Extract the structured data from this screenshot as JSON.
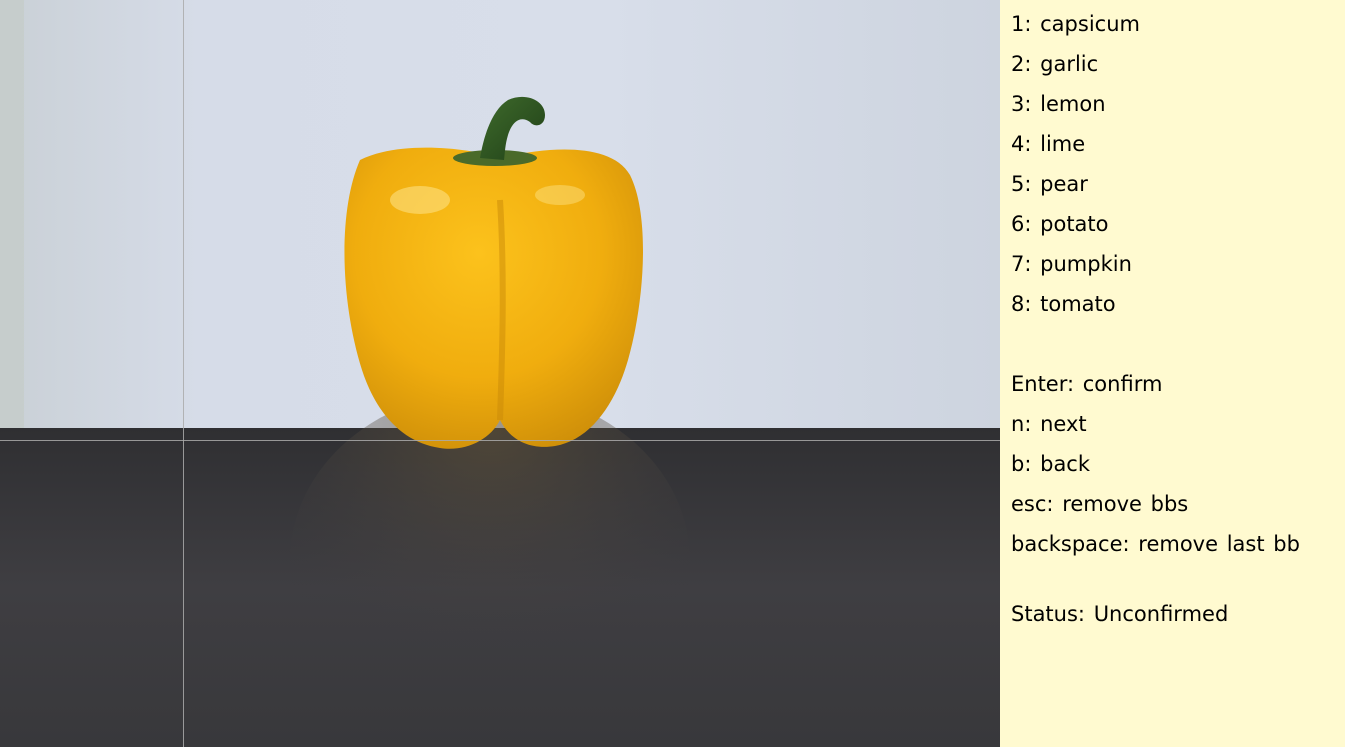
{
  "colors": {
    "panel_background": "#fffad0",
    "text": "#000000",
    "crosshair": "#aaaaaa",
    "pepper": "#f2b20f",
    "wall": "#cfd6e0",
    "table": "#3c3b3e"
  },
  "canvas": {
    "content": "yellow bell pepper on dark table against light wall"
  },
  "labels": [
    {
      "key": "1",
      "name": "capsicum"
    },
    {
      "key": "2",
      "name": "garlic"
    },
    {
      "key": "3",
      "name": "lemon"
    },
    {
      "key": "4",
      "name": "lime"
    },
    {
      "key": "5",
      "name": "pear"
    },
    {
      "key": "6",
      "name": "potato"
    },
    {
      "key": "7",
      "name": "pumpkin"
    },
    {
      "key": "8",
      "name": "tomato"
    }
  ],
  "shortcuts": [
    {
      "key": "Enter",
      "action": "confirm"
    },
    {
      "key": "n",
      "action": "next"
    },
    {
      "key": "b",
      "action": "back"
    },
    {
      "key": "esc",
      "action": "remove bbs"
    },
    {
      "key": "backspace",
      "action": "remove last bb"
    }
  ],
  "status": {
    "label": "Status",
    "value": "Unconfirmed"
  }
}
